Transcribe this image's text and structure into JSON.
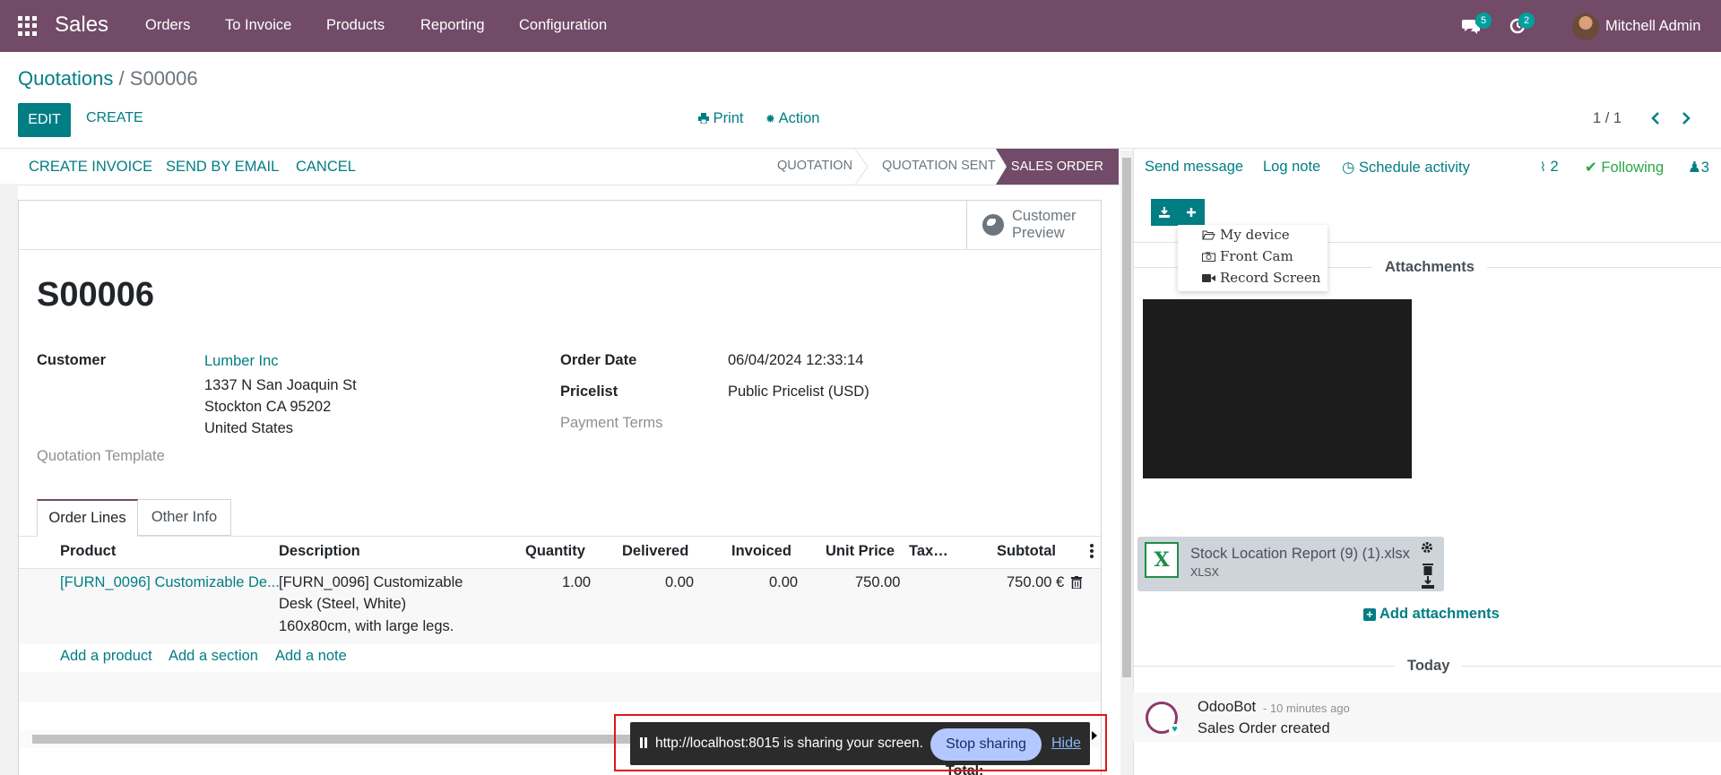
{
  "navbar": {
    "app_name": "Sales",
    "menu": [
      "Orders",
      "To Invoice",
      "Products",
      "Reporting",
      "Configuration"
    ],
    "messages_count": "5",
    "activities_count": "2",
    "user_name": "Mitchell Admin"
  },
  "breadcrumb": {
    "parent": "Quotations",
    "separator": "/",
    "current": "S00006"
  },
  "control_panel": {
    "edit_label": "EDIT",
    "create_label": "CREATE",
    "print_label": "Print",
    "action_label": "Action",
    "pager_value": "1 / 1"
  },
  "statusbar": {
    "buttons": [
      "CREATE INVOICE",
      "SEND BY EMAIL",
      "CANCEL"
    ],
    "stages": [
      "QUOTATION",
      "QUOTATION SENT",
      "SALES ORDER"
    ],
    "active_stage": "SALES ORDER"
  },
  "form": {
    "customer_preview_line1": "Customer",
    "customer_preview_line2": "Preview",
    "name": "S00006",
    "customer_label": "Customer",
    "customer_name": "Lumber Inc",
    "customer_address": [
      "1337 N San Joaquin St",
      "Stockton CA 95202",
      "United States"
    ],
    "quotation_template_label": "Quotation Template",
    "order_date_label": "Order Date",
    "order_date_value": "06/04/2024 12:33:14",
    "pricelist_label": "Pricelist",
    "pricelist_value": "Public Pricelist (USD)",
    "payment_terms_label": "Payment Terms",
    "total_label": "Total:"
  },
  "tabs": [
    "Order Lines",
    "Other Info"
  ],
  "order_lines": {
    "columns": [
      "Product",
      "Description",
      "Quantity",
      "Delivered",
      "Invoiced",
      "Unit Price",
      "Tax…",
      "Subtotal"
    ],
    "rows": [
      {
        "product": "[FURN_0096] Customizable De...",
        "description": [
          "[FURN_0096] Customizable",
          "Desk (Steel, White)",
          "160x80cm, with large legs."
        ],
        "quantity": "1.00",
        "delivered": "0.00",
        "invoiced": "0.00",
        "unit_price": "750.00",
        "taxes": "",
        "subtotal": "750.00 €"
      }
    ],
    "add_product": "Add a product",
    "add_section": "Add a section",
    "add_note": "Add a note"
  },
  "screen_share": {
    "message": "http://localhost:8015 is sharing your screen.",
    "stop_label": "Stop sharing",
    "hide_label": "Hide"
  },
  "chatter": {
    "send_message": "Send message",
    "log_note": "Log note",
    "schedule_activity": "Schedule activity",
    "attachments_count": "2",
    "following_label": "Following",
    "followers_count": "3",
    "upload_menu": [
      "My device",
      "Front Cam",
      "Record Screen"
    ],
    "attachments_title": "Attachments",
    "file_name": "Stock Location Report (9) (1).xlsx",
    "file_ext": "XLSX",
    "file_icon_letter": "X",
    "add_attachments": "Add attachments",
    "today_label": "Today",
    "message_author": "OdooBot",
    "message_date": "- 10 minutes ago",
    "message_body": "Sales Order created"
  },
  "colors": {
    "brand": "#714b67",
    "accent": "#017e84",
    "following": "#28a745",
    "badge": "#00a09d"
  }
}
